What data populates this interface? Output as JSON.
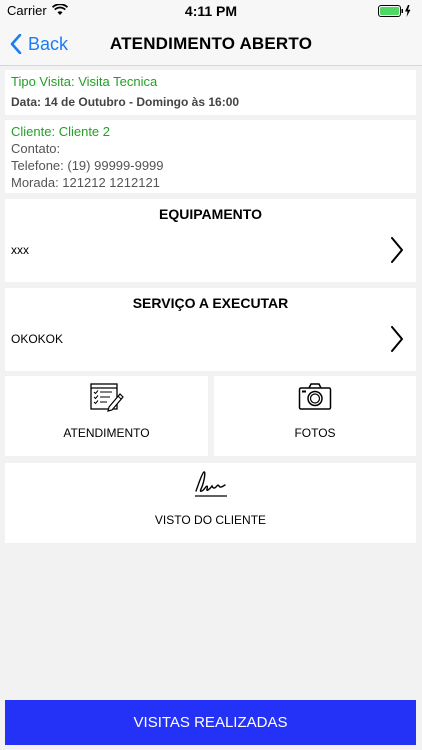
{
  "status_bar": {
    "carrier": "Carrier",
    "time": "4:11 PM"
  },
  "nav": {
    "back_label": "Back",
    "title": "ATENDIMENTO ABERTO"
  },
  "visit": {
    "tipo": "Tipo Visita: Visita Tecnica",
    "data": "Data: 14 de Outubro - Domingo às 16:00"
  },
  "client": {
    "cliente": "Cliente: Cliente 2",
    "contato": "Contato:",
    "telefone": "Telefone: (19) 99999-9999",
    "morada": "Morada: 121212 1212121"
  },
  "equipamento": {
    "title": "EQUIPAMENTO",
    "value": "xxx"
  },
  "servico": {
    "title": "SERVIÇO A EXECUTAR",
    "value": "OKOKOK"
  },
  "tiles": {
    "atendimento_label": "ATENDIMENTO",
    "fotos_label": "FOTOS",
    "visto_label": "VISTO DO CLIENTE"
  },
  "bottom": {
    "button_label": "VISITAS REALIZADAS"
  },
  "colors": {
    "accent": "#1b7cf4",
    "green_text": "#22a026",
    "bottom_button": "#2332f6"
  }
}
